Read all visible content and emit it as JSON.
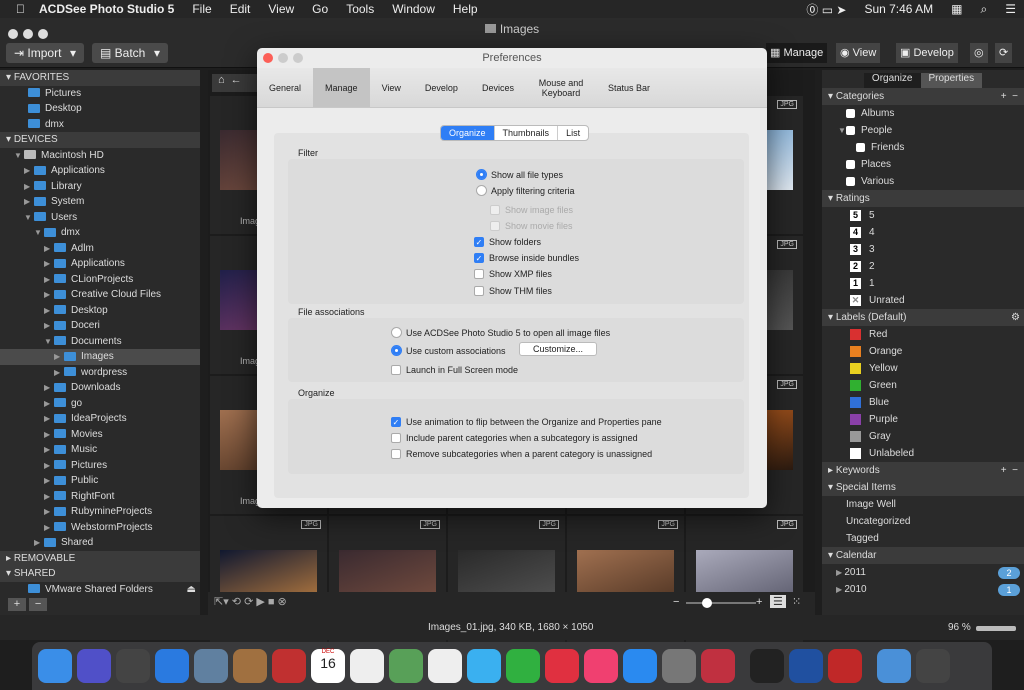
{
  "menubar": {
    "app": "ACDSee Photo Studio 5",
    "items": [
      "File",
      "Edit",
      "View",
      "Go",
      "Tools",
      "Window",
      "Help"
    ],
    "clock": "Sun 7:46 AM"
  },
  "window": {
    "title": "Images"
  },
  "toolbar": {
    "import": "Import",
    "batch": "Batch",
    "modes": [
      "Manage",
      "View",
      "Develop"
    ]
  },
  "sidebar": {
    "favorites": {
      "label": "FAVORITES",
      "items": [
        "Pictures",
        "Desktop",
        "dmx"
      ]
    },
    "devices": {
      "label": "DEVICES",
      "tree": [
        {
          "label": "Macintosh HD",
          "level": 1,
          "open": true
        },
        {
          "label": "Applications",
          "level": 2
        },
        {
          "label": "Library",
          "level": 2
        },
        {
          "label": "System",
          "level": 2
        },
        {
          "label": "Users",
          "level": 2,
          "open": true
        },
        {
          "label": "dmx",
          "level": 3,
          "open": true
        },
        {
          "label": "Adlm",
          "level": 4
        },
        {
          "label": "Applications",
          "level": 4
        },
        {
          "label": "CLionProjects",
          "level": 4
        },
        {
          "label": "Creative Cloud Files",
          "level": 4
        },
        {
          "label": "Desktop",
          "level": 4
        },
        {
          "label": "Doceri",
          "level": 4
        },
        {
          "label": "Documents",
          "level": 4,
          "open": true
        },
        {
          "label": "Images",
          "level": 5,
          "selected": true
        },
        {
          "label": "wordpress",
          "level": 5
        },
        {
          "label": "Downloads",
          "level": 4
        },
        {
          "label": "go",
          "level": 4
        },
        {
          "label": "IdeaProjects",
          "level": 4
        },
        {
          "label": "Movies",
          "level": 4
        },
        {
          "label": "Music",
          "level": 4
        },
        {
          "label": "Pictures",
          "level": 4
        },
        {
          "label": "Public",
          "level": 4
        },
        {
          "label": "RightFont",
          "level": 4
        },
        {
          "label": "RubymineProjects",
          "level": 4
        },
        {
          "label": "WebstormProjects",
          "level": 4
        },
        {
          "label": "Shared",
          "level": 3
        }
      ]
    },
    "removable": "REMOVABLE",
    "shared": {
      "label": "SHARED",
      "items": [
        "VMware Shared Folders"
      ]
    }
  },
  "browser": {
    "badge": "JPG",
    "caption": "Imag",
    "thumb_colors": [
      [
        "#3a2a30",
        "#7a5040"
      ],
      [
        "#2a2a2a",
        "#555"
      ],
      [
        "#a07050",
        "#4a3020"
      ],
      [
        "#aab",
        "#556"
      ],
      [
        "#6aa0d0",
        "#e0e8f0"
      ],
      [
        "#20204a",
        "#7a3a6a"
      ],
      [
        "#c86420",
        "#2a1a10"
      ],
      [
        "#101830",
        "#c08040"
      ]
    ]
  },
  "status": {
    "file_info": "Images_01.jpg, 340 KB, 1680 × 1050",
    "zoom": "96 %"
  },
  "right": {
    "tabs": [
      "Organize",
      "Properties"
    ],
    "categories": {
      "label": "Categories",
      "items": [
        {
          "label": "Albums",
          "level": 1
        },
        {
          "label": "People",
          "level": 1
        },
        {
          "label": "Friends",
          "level": 2
        },
        {
          "label": "Places",
          "level": 1
        },
        {
          "label": "Various",
          "level": 1
        }
      ]
    },
    "ratings": {
      "label": "Ratings",
      "items": [
        "5",
        "4",
        "3",
        "2",
        "1"
      ],
      "unrated": "Unrated"
    },
    "labels": {
      "label": "Labels (Default)",
      "items": [
        {
          "label": "Red",
          "color": "#d93030"
        },
        {
          "label": "Orange",
          "color": "#e88020"
        },
        {
          "label": "Yellow",
          "color": "#e8d020"
        },
        {
          "label": "Green",
          "color": "#30b030"
        },
        {
          "label": "Blue",
          "color": "#3070d8"
        },
        {
          "label": "Purple",
          "color": "#8a40a8"
        },
        {
          "label": "Gray",
          "color": "#999999"
        },
        {
          "label": "Unlabeled",
          "color": "#ffffff"
        }
      ]
    },
    "keywords": "Keywords",
    "special": {
      "label": "Special Items",
      "items": [
        "Image Well",
        "Uncategorized",
        "Tagged"
      ]
    },
    "calendar": {
      "label": "Calendar",
      "items": [
        {
          "label": "2011",
          "count": "2"
        },
        {
          "label": "2010",
          "count": "1"
        }
      ]
    }
  },
  "prefs": {
    "title": "Preferences",
    "tabs": [
      "General",
      "Manage",
      "View",
      "Develop",
      "Devices",
      "Mouse and Keyboard",
      "Status Bar"
    ],
    "active_tab": "Manage",
    "subtabs": [
      "Organize",
      "Thumbnails",
      "List"
    ],
    "filter": {
      "label": "Filter",
      "show_all": "Show all file types",
      "apply": "Apply filtering criteria",
      "show_image": "Show image files",
      "show_movie": "Show movie files",
      "show_folders": "Show folders",
      "browse_bundles": "Browse inside bundles",
      "show_xmp": "Show XMP files",
      "show_thm": "Show THM files"
    },
    "assoc": {
      "label": "File associations",
      "use_acdsee": "Use ACDSee Photo Studio 5 to open all image files",
      "use_custom": "Use custom associations",
      "customize": "Customize...",
      "fullscreen": "Launch in Full Screen mode"
    },
    "organize": {
      "label": "Organize",
      "anim": "Use animation to flip between the Organize and Properties pane",
      "parent": "Include parent categories when a subcategory is assigned",
      "remove": "Remove subcategories when a parent category is unassigned"
    }
  },
  "dock": {
    "calendar_day": "16",
    "calendar_month": "DEC",
    "colors": [
      "#3a8ee8",
      "#5050c8",
      "#444",
      "#2a7ae0",
      "#6080a0",
      "#a07040",
      "#c03030",
      "#f0e070",
      "#eee",
      "#58a058",
      "#eee",
      "#3ab0f0",
      "#30b040",
      "#e03040",
      "#f04070",
      "#2a8af0",
      "#777",
      "#c03040",
      "#222",
      "#2050a0",
      "#c02828",
      "#4a90d8",
      "#444"
    ]
  }
}
